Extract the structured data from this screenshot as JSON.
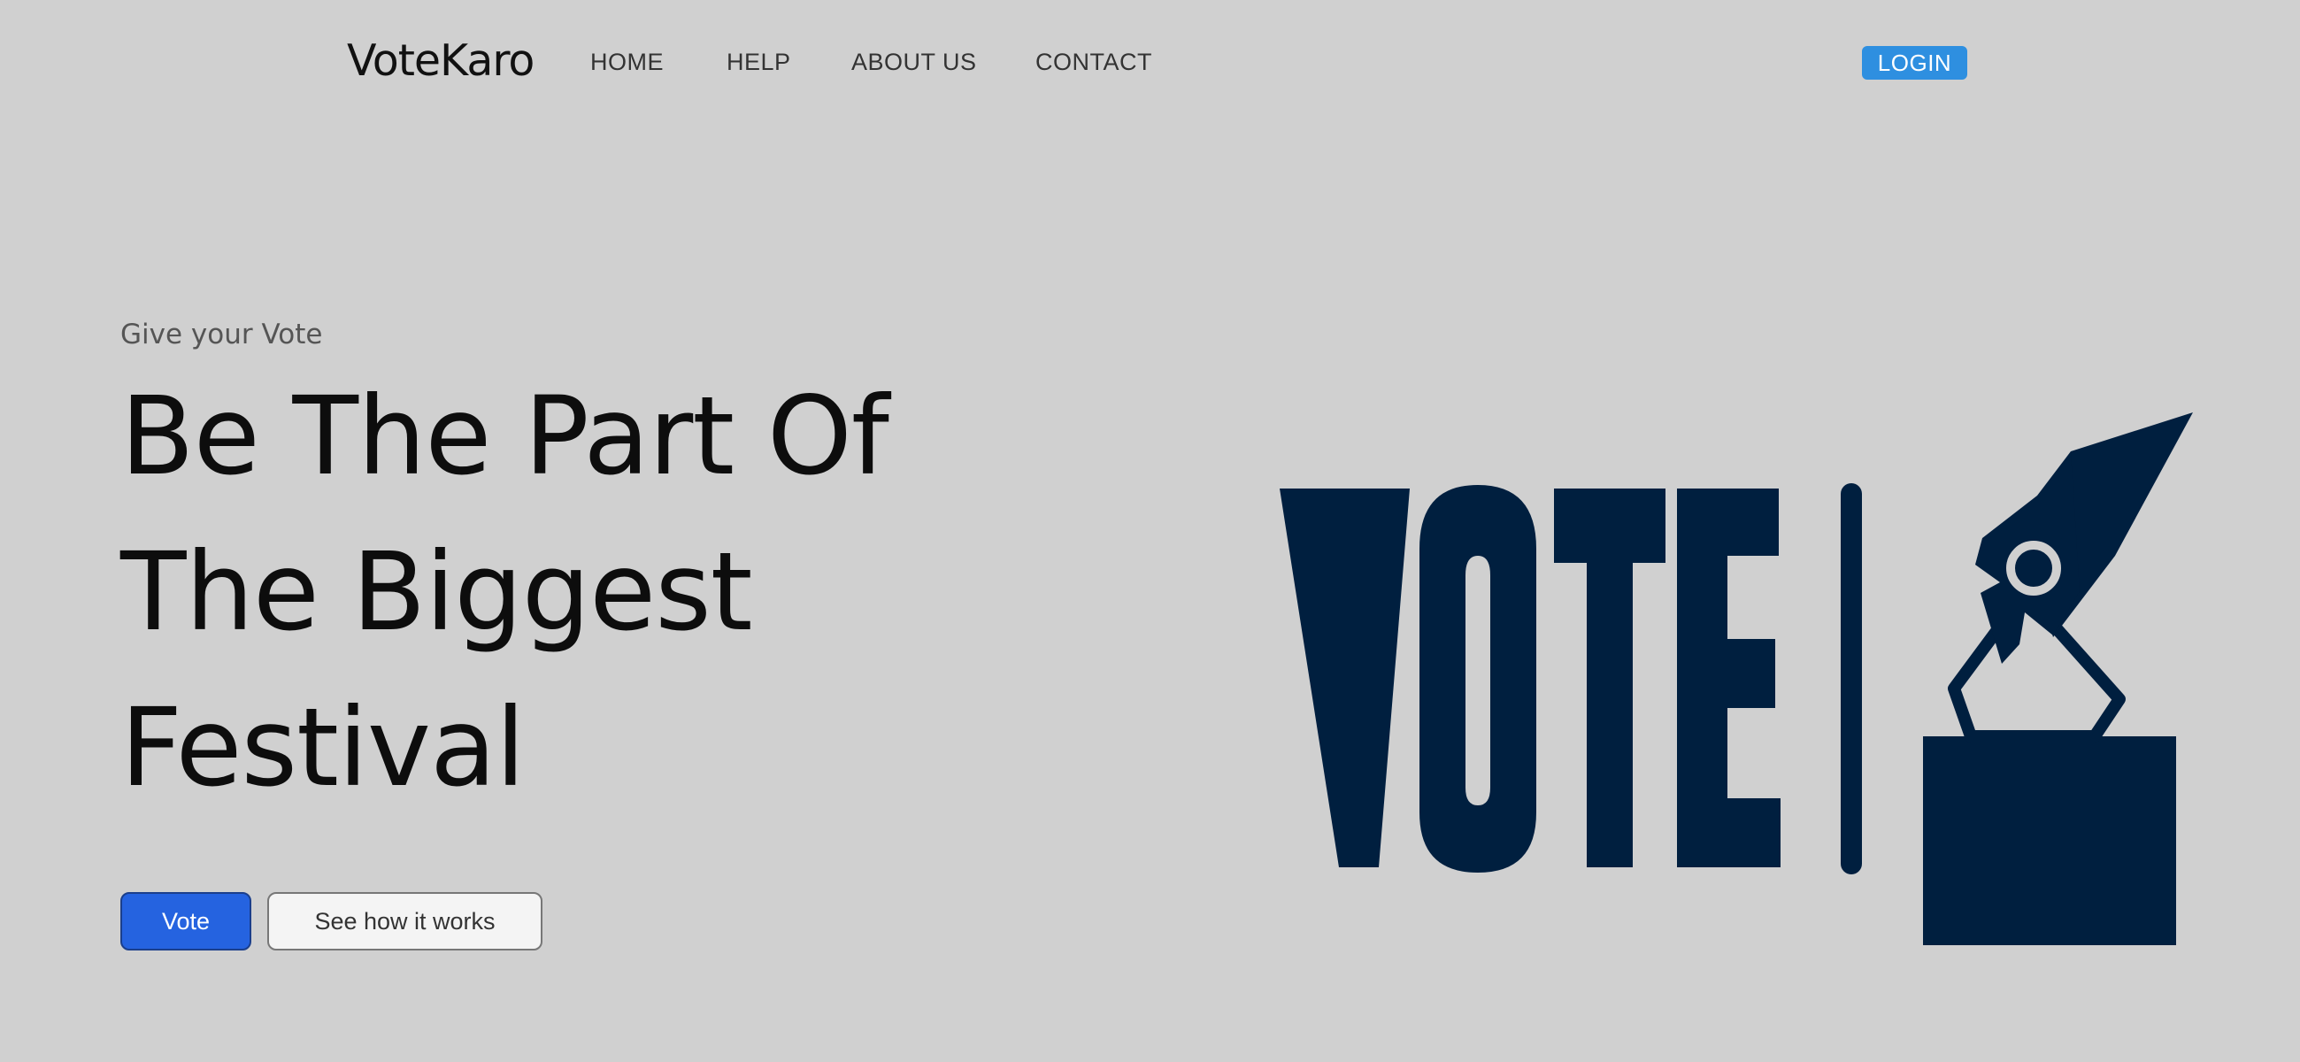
{
  "brand": "VoteKaro",
  "nav": {
    "items": [
      "HOME",
      "HELP",
      "ABOUT US",
      "CONTACT"
    ],
    "login_label": "LOGIN"
  },
  "hero": {
    "eyebrow": "Give your Vote",
    "headline_lines": [
      "Be The Part Of",
      "The Biggest",
      "Festival"
    ],
    "primary_button": "Vote",
    "secondary_button": "See how it works"
  },
  "illustration": {
    "text": "VOTE",
    "icon": "ballot-box-icon"
  },
  "colors": {
    "background": "#d0d0d0",
    "illustration": "#001f3f",
    "primary": "#2563e0",
    "login": "#2e8fe0"
  }
}
